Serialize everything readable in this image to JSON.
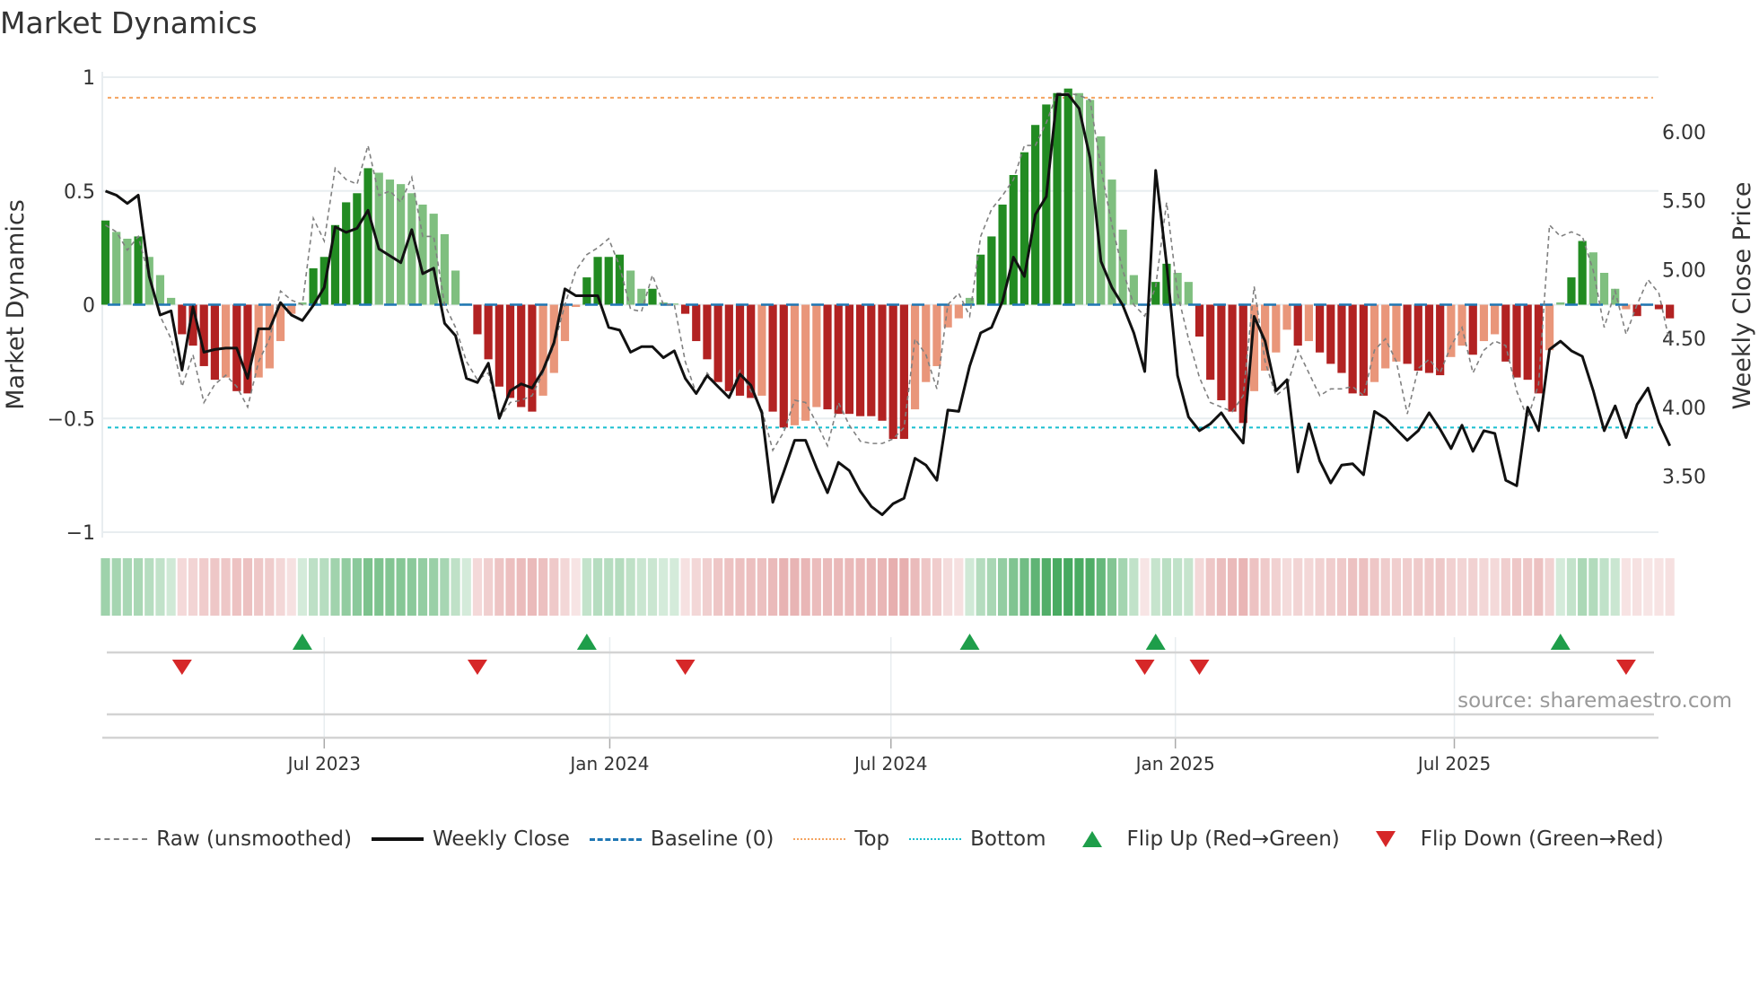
{
  "chart_data": {
    "type": "bar",
    "title": "Market Dynamics",
    "ylabel": "Market Dynamics",
    "y2label": "Weekly Close Price",
    "ylim": [
      -1,
      1
    ],
    "y2lim": [
      3.093,
      6.397
    ],
    "yticks": [
      "1",
      "0.5",
      "0",
      "−0.5",
      "−1"
    ],
    "ytick_values": [
      1,
      0.5,
      0,
      -0.5,
      -1
    ],
    "y2ticks": [
      "6.00",
      "5.50",
      "5.00",
      "4.50",
      "4.00",
      "3.50"
    ],
    "y2tick_values": [
      6.0,
      5.5,
      5.0,
      4.5,
      4.0,
      3.5
    ],
    "x_frequency": "weekly",
    "xticks": [
      {
        "label": "Jul 2023",
        "week_index": 20.0
      },
      {
        "label": "Jan 2024",
        "week_index": 46.1
      },
      {
        "label": "Jul 2024",
        "week_index": 71.8
      },
      {
        "label": "Jan 2025",
        "week_index": 97.8
      },
      {
        "label": "Jul 2025",
        "week_index": 123.3
      }
    ],
    "top_level": 0.91,
    "bottom_level": -0.54,
    "baseline": 0,
    "grid": true,
    "legend_placement": "bottom",
    "series": [
      {
        "name": "Market Dynamics (smoothed)",
        "type": "bar",
        "values": [
          0.37,
          0.32,
          0.29,
          0.3,
          0.21,
          0.13,
          0.03,
          -0.13,
          -0.18,
          -0.27,
          -0.33,
          -0.32,
          -0.38,
          -0.39,
          -0.32,
          -0.28,
          -0.16,
          -0.04,
          0.01,
          0.16,
          0.21,
          0.35,
          0.45,
          0.49,
          0.6,
          0.58,
          0.55,
          0.53,
          0.49,
          0.44,
          0.4,
          0.31,
          0.15,
          0.005,
          -0.13,
          -0.24,
          -0.36,
          -0.41,
          -0.45,
          -0.47,
          -0.4,
          -0.3,
          -0.16,
          -0.01,
          0.12,
          0.21,
          0.21,
          0.22,
          0.15,
          0.07,
          0.07,
          0.01,
          0.005,
          -0.04,
          -0.16,
          -0.24,
          -0.34,
          -0.38,
          -0.4,
          -0.41,
          -0.4,
          -0.47,
          -0.54,
          -0.53,
          -0.51,
          -0.45,
          -0.46,
          -0.48,
          -0.48,
          -0.49,
          -0.49,
          -0.51,
          -0.59,
          -0.59,
          -0.46,
          -0.34,
          -0.27,
          -0.1,
          -0.06,
          0.03,
          0.22,
          0.3,
          0.44,
          0.57,
          0.67,
          0.79,
          0.88,
          0.93,
          0.95,
          0.93,
          0.9,
          0.74,
          0.55,
          0.33,
          0.13,
          -0.005,
          0.1,
          0.18,
          0.14,
          0.1,
          -0.14,
          -0.33,
          -0.42,
          -0.47,
          -0.52,
          -0.38,
          -0.29,
          -0.21,
          -0.11,
          -0.18,
          -0.16,
          -0.21,
          -0.26,
          -0.3,
          -0.39,
          -0.4,
          -0.34,
          -0.28,
          -0.25,
          -0.26,
          -0.29,
          -0.3,
          -0.31,
          -0.23,
          -0.18,
          -0.22,
          -0.16,
          -0.13,
          -0.25,
          -0.32,
          -0.33,
          -0.39,
          -0.2,
          0.01,
          0.12,
          0.28,
          0.23,
          0.14,
          0.07,
          -0.02,
          -0.05,
          -0.005,
          -0.02,
          -0.06
        ]
      },
      {
        "name": "Raw (unsmoothed)",
        "type": "line",
        "values": [
          0.35,
          0.32,
          0.24,
          0.3,
          0.12,
          -0.05,
          -0.15,
          -0.36,
          -0.22,
          -0.43,
          -0.35,
          -0.31,
          -0.36,
          -0.45,
          -0.25,
          -0.15,
          0.06,
          0.02,
          0.0,
          0.38,
          0.28,
          0.6,
          0.55,
          0.53,
          0.7,
          0.48,
          0.5,
          0.45,
          0.56,
          0.3,
          0.3,
          0.0,
          -0.1,
          -0.25,
          -0.33,
          -0.3,
          -0.5,
          -0.43,
          -0.42,
          -0.4,
          -0.3,
          -0.18,
          0.0,
          0.15,
          0.22,
          0.25,
          0.29,
          0.17,
          -0.02,
          -0.03,
          0.13,
          0.0,
          0.0,
          -0.25,
          -0.39,
          -0.3,
          -0.36,
          -0.4,
          -0.29,
          -0.38,
          -0.46,
          -0.64,
          -0.56,
          -0.42,
          -0.43,
          -0.52,
          -0.62,
          -0.43,
          -0.53,
          -0.6,
          -0.61,
          -0.61,
          -0.59,
          -0.54,
          -0.15,
          -0.22,
          -0.37,
          0.0,
          0.05,
          -0.05,
          0.3,
          0.42,
          0.48,
          0.55,
          0.7,
          0.7,
          0.8,
          0.93,
          0.93,
          0.92,
          0.9,
          0.6,
          0.35,
          0.15,
          0.0,
          -0.05,
          0.08,
          0.45,
          0.05,
          -0.15,
          -0.32,
          -0.43,
          -0.45,
          -0.47,
          -0.4,
          0.08,
          -0.25,
          -0.4,
          -0.36,
          -0.2,
          -0.3,
          -0.4,
          -0.37,
          -0.37,
          -0.36,
          -0.4,
          -0.2,
          -0.15,
          -0.25,
          -0.48,
          -0.28,
          -0.24,
          -0.3,
          -0.18,
          -0.1,
          -0.3,
          -0.2,
          -0.16,
          -0.18,
          -0.38,
          -0.5,
          -0.35,
          0.35,
          0.3,
          0.32,
          0.3,
          0.15,
          -0.1,
          0.06,
          -0.13,
          0.0,
          0.11,
          0.05,
          -0.17
        ]
      },
      {
        "name": "Weekly Close",
        "type": "line",
        "axis": "right",
        "values": [
          5.57,
          5.54,
          5.48,
          5.54,
          4.95,
          4.67,
          4.7,
          4.27,
          4.73,
          4.4,
          4.42,
          4.43,
          4.43,
          4.21,
          4.57,
          4.57,
          4.76,
          4.67,
          4.63,
          4.74,
          4.87,
          5.31,
          5.27,
          5.3,
          5.43,
          5.15,
          5.1,
          5.05,
          5.29,
          4.97,
          5.01,
          4.61,
          4.52,
          4.21,
          4.18,
          4.32,
          3.92,
          4.12,
          4.17,
          4.14,
          4.27,
          4.47,
          4.86,
          4.81,
          4.81,
          4.81,
          4.58,
          4.56,
          4.4,
          4.44,
          4.44,
          4.36,
          4.41,
          4.21,
          4.1,
          4.23,
          4.15,
          4.07,
          4.24,
          4.16,
          3.96,
          3.31,
          3.53,
          3.76,
          3.76,
          3.56,
          3.38,
          3.6,
          3.54,
          3.39,
          3.28,
          3.22,
          3.3,
          3.34,
          3.63,
          3.58,
          3.47,
          3.98,
          3.97,
          4.3,
          4.54,
          4.58,
          4.77,
          5.09,
          4.95,
          5.4,
          5.53,
          6.27,
          6.27,
          6.17,
          5.81,
          5.06,
          4.87,
          4.74,
          4.54,
          4.26,
          5.72,
          5.04,
          4.23,
          3.93,
          3.83,
          3.88,
          3.96,
          3.84,
          3.74,
          4.66,
          4.48,
          4.12,
          4.2,
          3.53,
          3.88,
          3.61,
          3.45,
          3.58,
          3.59,
          3.51,
          3.97,
          3.92,
          3.84,
          3.76,
          3.83,
          3.96,
          3.84,
          3.7,
          3.87,
          3.68,
          3.83,
          3.81,
          3.47,
          3.43,
          4.0,
          3.83,
          4.42,
          4.48,
          4.41,
          4.37,
          4.12,
          3.83,
          4.01,
          3.78,
          4.02,
          4.14,
          3.89,
          3.72
        ]
      }
    ],
    "flip_up_week_index": [
      18,
      44,
      79,
      96,
      133
    ],
    "flip_down_week_index": [
      7,
      34,
      53,
      95,
      100,
      139
    ],
    "colors": {
      "green_strong": "#228b22",
      "green_weak": "#7fbf7f",
      "red_strong": "#b22222",
      "red_weak": "#e9967a",
      "raw": "#808080",
      "close": "#111111",
      "baseline": "#1f77b4",
      "top": "#f4a460",
      "bottom": "#17becf",
      "flip_up": "#1e9e4a",
      "flip_down": "#d62728"
    }
  },
  "legend": [
    {
      "label": "Raw (unsmoothed)",
      "kind": "raw"
    },
    {
      "label": "Weekly Close",
      "kind": "close"
    },
    {
      "label": "Baseline (0)",
      "kind": "baseline"
    },
    {
      "label": "Top",
      "kind": "top"
    },
    {
      "label": "Bottom",
      "kind": "bottom"
    },
    {
      "label": "Flip Up (Red→Green)",
      "kind": "up"
    },
    {
      "label": "Flip Down (Green→Red)",
      "kind": "down"
    }
  ],
  "source": "source: sharemaestro.com"
}
